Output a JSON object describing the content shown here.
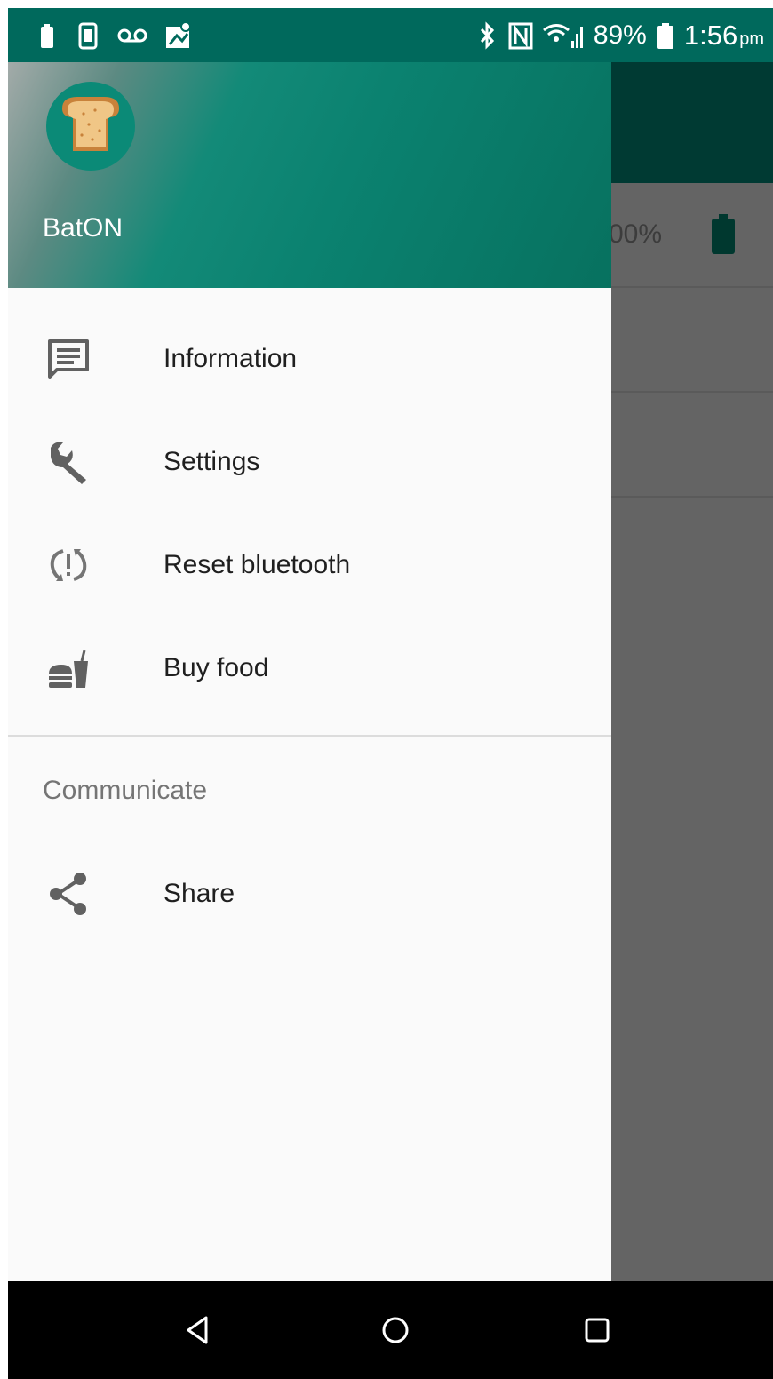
{
  "status_bar": {
    "battery_percent": "89%",
    "time": "1:56",
    "time_suffix": "pm",
    "icons_left": [
      "battery-saver-icon",
      "phone-display-icon",
      "voicemail-icon",
      "map-icon"
    ],
    "icons_right": [
      "bluetooth-icon",
      "nfc-icon",
      "wifi-icon",
      "signal-icon",
      "battery-icon"
    ]
  },
  "background_app": {
    "battery_text": "00%"
  },
  "drawer": {
    "header": {
      "app_name": "BatON",
      "avatar_icon": "toast-icon"
    },
    "items": [
      {
        "label": "Information",
        "icon": "message-icon"
      },
      {
        "label": "Settings",
        "icon": "wrench-icon"
      },
      {
        "label": "Reset bluetooth",
        "icon": "refresh-alert-icon"
      },
      {
        "label": "Buy food",
        "icon": "food-icon"
      }
    ],
    "section": {
      "title": "Communicate",
      "items": [
        {
          "label": "Share",
          "icon": "share-icon"
        }
      ]
    }
  },
  "nav_bar": {
    "buttons": [
      "back-icon",
      "home-icon",
      "recents-icon"
    ]
  },
  "colors": {
    "primary": "#00695c",
    "primary_dark": "#003a33",
    "drawer_bg": "#fafafa",
    "icon_gray": "#616161"
  }
}
